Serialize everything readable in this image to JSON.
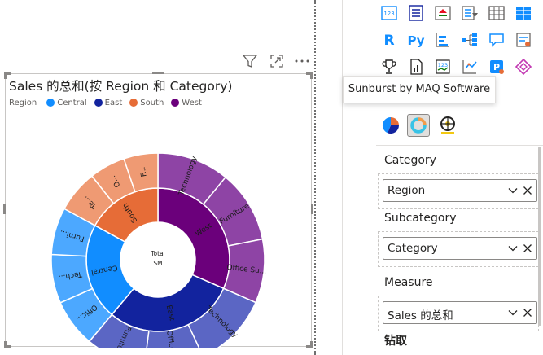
{
  "canvas": {
    "chart_title": "Sales 的总和(按 Region 和 Category)",
    "legend_title": "Region",
    "legend": [
      {
        "name": "Central",
        "color": "#118DFF"
      },
      {
        "name": "East",
        "color": "#12239E"
      },
      {
        "name": "South",
        "color": "#E66C37"
      },
      {
        "name": "West",
        "color": "#6B007B"
      }
    ],
    "visual_header_icons": [
      "filter-icon",
      "focus-mode-icon",
      "more-options-icon"
    ]
  },
  "chart_data": {
    "type": "sunburst",
    "center_label_lines": [
      "Total",
      "SM"
    ],
    "inner": [
      {
        "name": "West",
        "value": 725,
        "color": "#6B007B",
        "label": "West"
      },
      {
        "name": "East",
        "value": 679,
        "color": "#12239E",
        "label": "East"
      },
      {
        "name": "Central",
        "value": 501,
        "color": "#118DFF",
        "label": "Central"
      },
      {
        "name": "South",
        "value": 392,
        "color": "#E66C37",
        "label": "South"
      }
    ],
    "outer": [
      {
        "parent": "West",
        "name": "Technology",
        "value": 251,
        "color": "#8E44A5",
        "label": "Technology"
      },
      {
        "parent": "West",
        "name": "Furniture",
        "value": 252,
        "color": "#8E44A5",
        "label": "Furniture"
      },
      {
        "parent": "West",
        "name": "Office Supplies",
        "value": 222,
        "color": "#8E44A5",
        "label": "Office Su..."
      },
      {
        "parent": "East",
        "name": "Technology",
        "value": 264,
        "color": "#5B66C4",
        "label": "Technology"
      },
      {
        "parent": "East",
        "name": "Office Supplies",
        "value": 206,
        "color": "#5B66C4",
        "label": "Office S..."
      },
      {
        "parent": "East",
        "name": "Furniture",
        "value": 209,
        "color": "#5B66C4",
        "label": "Furniture"
      },
      {
        "parent": "Central",
        "name": "Office Supplies",
        "value": 167,
        "color": "#4CA8FF",
        "label": "Offic..."
      },
      {
        "parent": "Central",
        "name": "Technology",
        "value": 170,
        "color": "#4CA8FF",
        "label": "Tech..."
      },
      {
        "parent": "Central",
        "name": "Furniture",
        "value": 164,
        "color": "#4CA8FF",
        "label": "Furni..."
      },
      {
        "parent": "South",
        "name": "Technology",
        "value": 148,
        "color": "#EF9A73",
        "label": "Te..."
      },
      {
        "parent": "South",
        "name": "Office Supplies",
        "value": 125,
        "color": "#EF9A73",
        "label": "O..."
      },
      {
        "parent": "South",
        "name": "Furniture",
        "value": 119,
        "color": "#EF9A73",
        "label": "F..."
      }
    ]
  },
  "pane": {
    "tooltip": "Sunburst by MAQ Software",
    "sections": [
      {
        "label": "Category",
        "field": "Region"
      },
      {
        "label": "Subcategory",
        "field": "Category"
      },
      {
        "label": "Measure",
        "field": "Sales 的总和"
      }
    ],
    "drill_label": "钻取",
    "viz_icons": [
      "matrix-icon",
      "card-icon",
      "kpi-icon",
      "slicer-icon",
      "table-icon",
      "multirow-card-icon",
      "r-visual-icon",
      "python-visual-icon",
      "key-influencers-icon",
      "decomposition-tree-icon",
      "qa-icon",
      "smart-narrative-icon",
      "trophy-icon",
      "paginated-report-icon",
      "power-apps-icon",
      "power-automate-icon",
      "metrics-icon",
      "more-visuals-icon"
    ],
    "custom_icons": [
      "custom-visual-pie-icon",
      "sunburst-icon",
      "custom-visual-wheel-icon"
    ]
  }
}
